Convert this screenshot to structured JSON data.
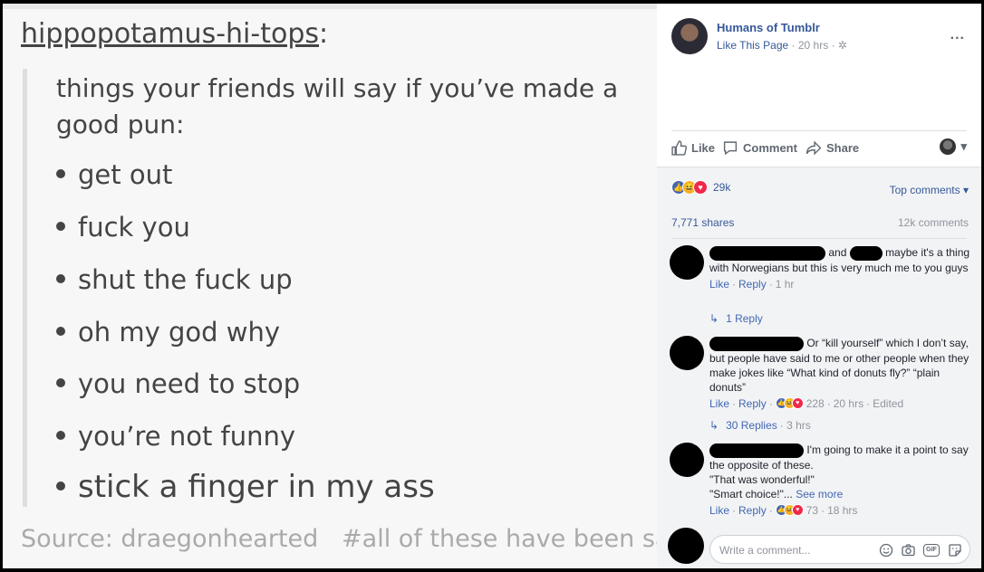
{
  "post": {
    "username": "hippopotamus-hi-tops",
    "colon": ":",
    "heading": "things your friends will say if you’ve made a good pun:",
    "bullets": [
      "get out",
      "fuck you",
      "shut the fuck up",
      "oh my god why",
      "you need to stop",
      "you’re not funny",
      "stick a finger in my ass"
    ],
    "source": "Source: draegonhearted",
    "tags": "#all of these have been sa"
  },
  "page": {
    "name": "Humans of Tumblr",
    "like_page": "Like This Page",
    "time": "20 hrs",
    "more": "..."
  },
  "actions": {
    "like": "Like",
    "comment": "Comment",
    "share": "Share"
  },
  "stats": {
    "reactions": "29k",
    "top_comments": "Top comments",
    "shares": "7,771 shares",
    "comments": "12k comments"
  },
  "comments": [
    {
      "text_mid": "and",
      "text": "maybe it's a thing with Norwegians but this is very much me to you guys",
      "like": "Like",
      "reply": "Reply",
      "time": "1 hr",
      "replies": "1 Reply"
    },
    {
      "text": "Or “kill yourself” which I don’t say, but people have said to me or other people when they make jokes like “What kind of donuts fly?” “plain donuts”",
      "like": "Like",
      "reply": "Reply",
      "reactions": "228",
      "time": "20 hrs",
      "edited": "Edited",
      "replies": "30 Replies",
      "replies_time": "3 hrs"
    },
    {
      "text": "I'm going to make it a point to say the opposite of these.",
      "line2": "\"That was wonderful!\"",
      "line3": "\"Smart choice!\"...",
      "see_more": "See more",
      "like": "Like",
      "reply": "Reply",
      "reactions": "73",
      "time": "18 hrs"
    }
  ],
  "composer": {
    "placeholder": "Write a comment..."
  },
  "colors": {
    "fb_blue": "#365899",
    "link_blue": "#4267b2",
    "gray_text": "#90949c",
    "tumblr_text": "#444444"
  }
}
